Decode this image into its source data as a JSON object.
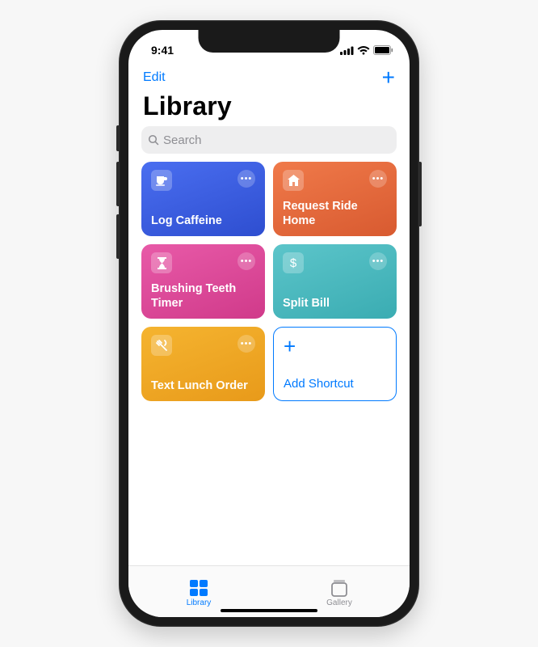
{
  "status": {
    "time": "9:41"
  },
  "nav": {
    "edit": "Edit"
  },
  "title": "Library",
  "search": {
    "placeholder": "Search"
  },
  "tiles": [
    {
      "label": "Log Caffeine",
      "icon": "mug",
      "color": "blue"
    },
    {
      "label": "Request Ride Home",
      "icon": "home",
      "color": "orange"
    },
    {
      "label": "Brushing Teeth Timer",
      "icon": "timer",
      "color": "pink"
    },
    {
      "label": "Split Bill",
      "icon": "dollar",
      "color": "teal"
    },
    {
      "label": "Text Lunch Order",
      "icon": "utensils",
      "color": "yellow"
    }
  ],
  "add_tile": {
    "label": "Add Shortcut"
  },
  "tabs": {
    "library": "Library",
    "gallery": "Gallery"
  }
}
